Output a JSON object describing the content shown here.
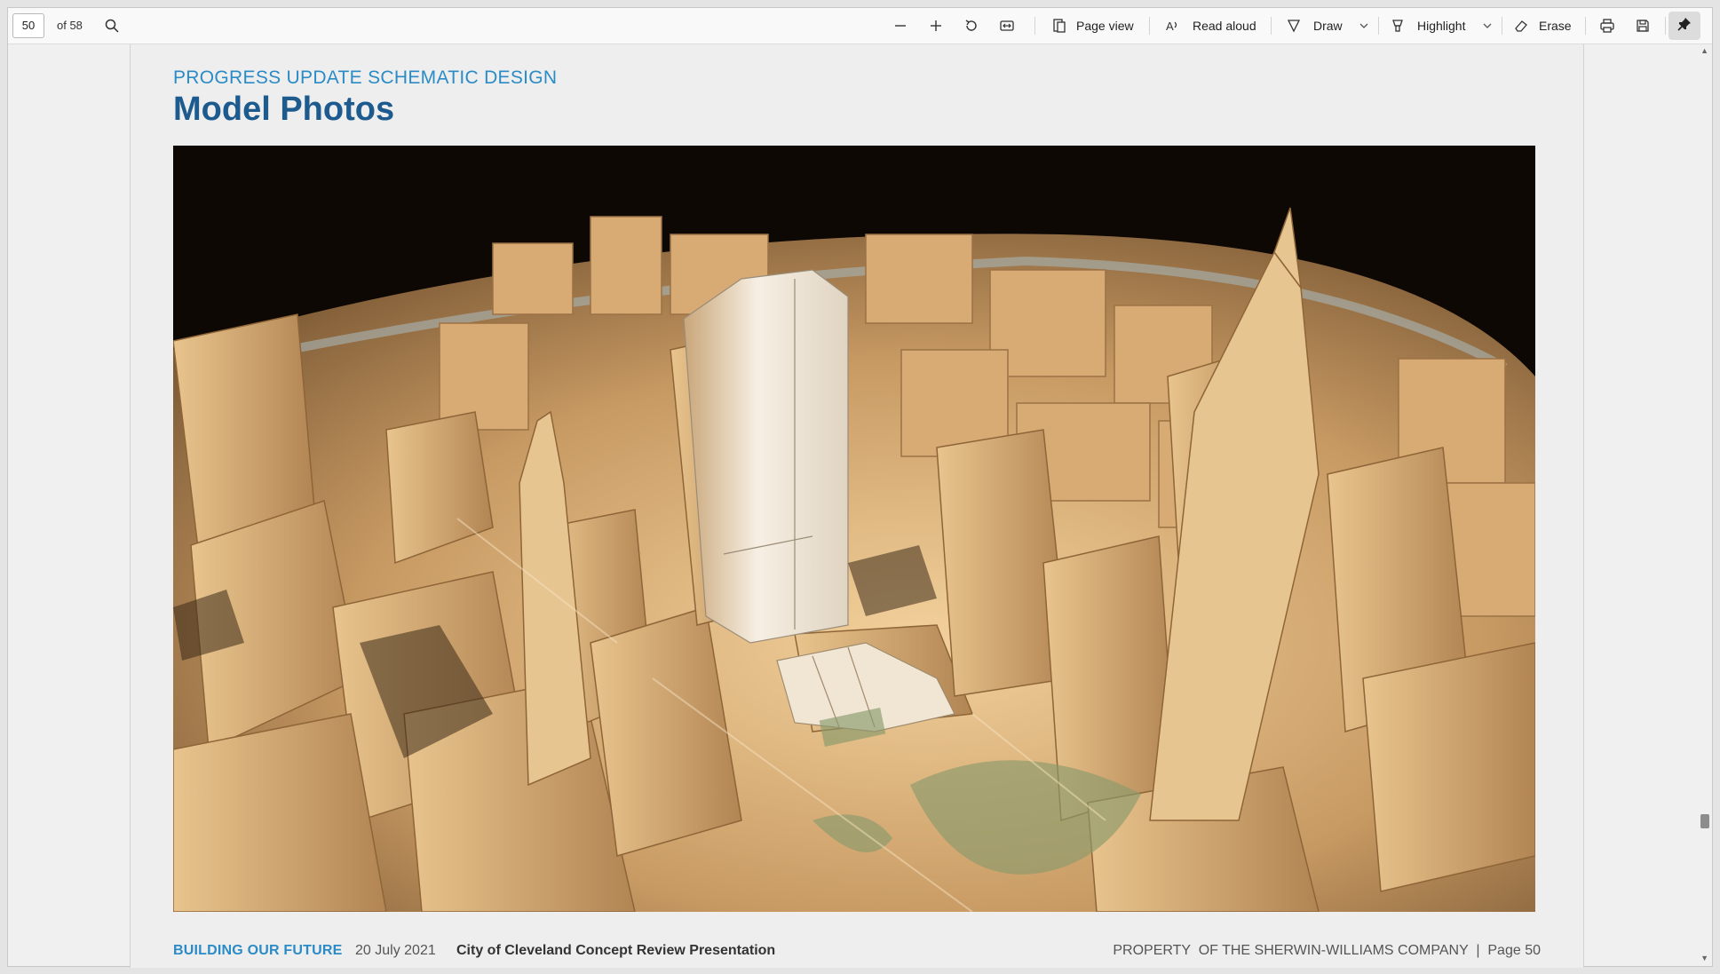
{
  "toolbar": {
    "page_number": "50",
    "page_total": "of 58",
    "page_view": "Page view",
    "read_aloud": "Read aloud",
    "draw": "Draw",
    "highlight": "Highlight",
    "erase": "Erase"
  },
  "document": {
    "subtitle": "PROGRESS UPDATE SCHEMATIC DESIGN",
    "title": "Model Photos",
    "footer": {
      "brand": "BUILDING OUR FUTURE",
      "date": "20 July 2021",
      "presentation": "City of Cleveland Concept Review Presentation",
      "property": "PROPERTY  OF THE SHERWIN-WILLIAMS COMPANY  |  Page 50"
    }
  },
  "colors": {
    "accent_blue": "#2b8bc6",
    "title_blue": "#1d5a8e",
    "model_tan": "#d9b07a"
  }
}
